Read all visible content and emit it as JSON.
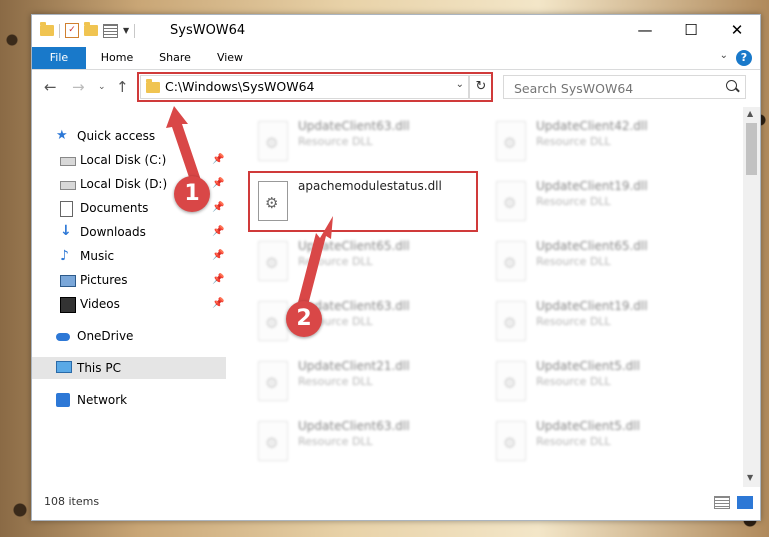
{
  "window": {
    "title": "SysWOW64"
  },
  "ribbon": {
    "tabs": [
      "File",
      "Home",
      "Share",
      "View"
    ],
    "help": "?"
  },
  "address": {
    "path": "C:\\Windows\\SysWOW64"
  },
  "search": {
    "placeholder": "Search SysWOW64"
  },
  "sidebar": {
    "items": [
      {
        "label": "Quick access"
      },
      {
        "label": "Local Disk (C:)"
      },
      {
        "label": "Local Disk (D:)"
      },
      {
        "label": "Documents"
      },
      {
        "label": "Downloads"
      },
      {
        "label": "Music"
      },
      {
        "label": "Pictures"
      },
      {
        "label": "Videos"
      },
      {
        "label": "OneDrive"
      },
      {
        "label": "This PC"
      },
      {
        "label": "Network"
      }
    ]
  },
  "files": [
    {
      "name": "UpdateClient63.dll",
      "type": "Resource DLL"
    },
    {
      "name": "UpdateClient42.dll",
      "type": "Resource DLL"
    },
    {
      "name": "apachemodulestatus.dll",
      "type": ""
    },
    {
      "name": "UpdateClient19.dll",
      "type": "Resource DLL"
    },
    {
      "name": "UpdateClient65.dll",
      "type": "Resource DLL"
    },
    {
      "name": "UpdateClient65.dll",
      "type": "Resource DLL"
    },
    {
      "name": "UpdateClient63.dll",
      "type": "Resource DLL"
    },
    {
      "name": "UpdateClient19.dll",
      "type": "Resource DLL"
    },
    {
      "name": "UpdateClient21.dll",
      "type": "Resource DLL"
    },
    {
      "name": "UpdateClient5.dll",
      "type": "Resource DLL"
    },
    {
      "name": "UpdateClient63.dll",
      "type": "Resource DLL"
    },
    {
      "name": "UpdateClient5.dll",
      "type": "Resource DLL"
    }
  ],
  "status": {
    "count": "108 items"
  },
  "callouts": [
    "1",
    "2"
  ],
  "colors": {
    "accent": "#1979ca",
    "highlight": "#d03a3a",
    "callout": "#d94747"
  }
}
